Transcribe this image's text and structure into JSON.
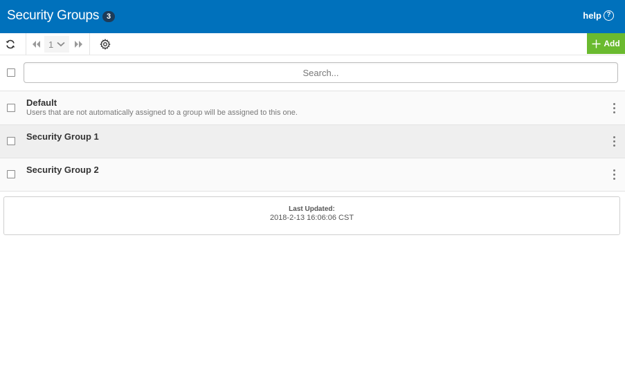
{
  "header": {
    "title": "Security Groups",
    "count": "3",
    "help_label": "help",
    "help_symbol": "?",
    "bg_color": "#0071bc"
  },
  "toolbar": {
    "refresh_icon": "refresh-icon",
    "first_page_icon": "double-chevron-left-icon",
    "page_number": "1",
    "page_dropdown_icon": "chevron-down-icon",
    "last_page_icon": "double-chevron-right-icon",
    "settings_icon": "gear-icon",
    "add_label": "Add",
    "add_color": "#6aba2f"
  },
  "search": {
    "placeholder": "Search...",
    "value": ""
  },
  "groups": [
    {
      "name": "Default",
      "description": "Users that are not automatically assigned to a group will be assigned to this one."
    },
    {
      "name": "Security Group 1",
      "description": ""
    },
    {
      "name": "Security Group 2",
      "description": ""
    }
  ],
  "footer": {
    "last_updated_label": "Last Updated:",
    "last_updated_value": "2018-2-13 16:06:06 CST"
  }
}
